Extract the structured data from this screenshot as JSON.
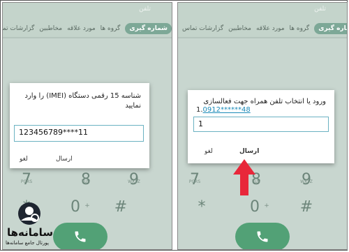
{
  "app": {
    "title": "تلفن"
  },
  "tabs": [
    "شماره گیری",
    "گروه ها",
    "مورد علاقه",
    "مخاطبین",
    "گزارشات تماس"
  ],
  "left_dialog": {
    "message": "شناسه 15 رقمی دستگاه (IMEI) را وارد نمایید",
    "input_value": "123456789****11",
    "cancel_label": "لغو",
    "send_label": "ارسال"
  },
  "right_dialog": {
    "message": "ورود یا انتخاب تلفن همراه جهت فعالسازی",
    "number_prefix": "1.",
    "number_link": "0912******48",
    "input_value": "1",
    "cancel_label": "لغو",
    "send_label": "ارسال"
  },
  "keypad": {
    "row1": [
      {
        "d": "7",
        "s": "PQRS"
      },
      {
        "d": "8",
        "s": "TUV"
      },
      {
        "d": "9",
        "s": "WXYZ"
      }
    ],
    "row2": [
      {
        "d": "*",
        "s": ""
      },
      {
        "d": "0",
        "s": "+"
      },
      {
        "d": "#",
        "s": ""
      }
    ]
  },
  "watermark": {
    "name": "سامانه‌ها",
    "tagline": "پورتال جامع سامانه‌ها"
  },
  "colors": {
    "accent": "#52a176",
    "highlight": "#e8273a",
    "tab_active": "#7da897"
  }
}
